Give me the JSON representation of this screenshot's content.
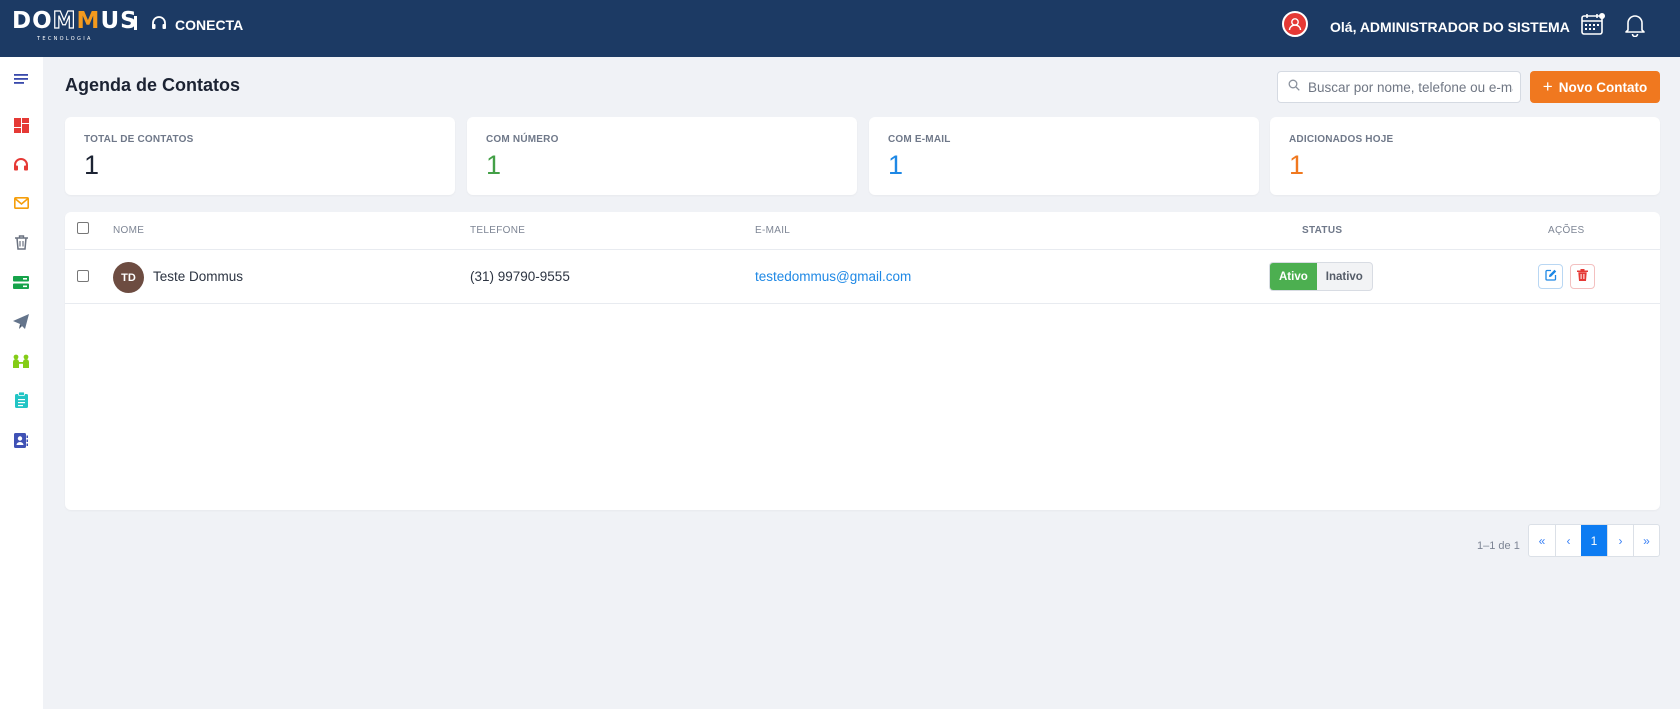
{
  "header": {
    "logo_text_a": "DO",
    "logo_text_m1": "M",
    "logo_text_m2": "M",
    "logo_text_b": "US",
    "logo_sub": "TECNOLOGIA",
    "app_name": "CONECTA",
    "greeting": "Olá, ADMINISTRADOR DO SISTEMA",
    "icons": [
      "headset-icon",
      "user-circle-icon",
      "calendar-icon",
      "bell-icon"
    ]
  },
  "sidebar": {
    "items": [
      {
        "name": "menu-toggle",
        "icon": "menu-icon",
        "color": "#3949ab"
      },
      {
        "name": "dashboard",
        "icon": "dashboard-icon",
        "color": "#e53935"
      },
      {
        "name": "atendimento",
        "icon": "headset-icon",
        "color": "#e53935"
      },
      {
        "name": "email",
        "icon": "envelope-icon",
        "color": "#f59e0b"
      },
      {
        "name": "lixeira",
        "icon": "trash-icon",
        "color": "#6b7280"
      },
      {
        "name": "servidores",
        "icon": "server-icon",
        "color": "#16a34a"
      },
      {
        "name": "envios",
        "icon": "paper-plane-icon",
        "color": "#64748b"
      },
      {
        "name": "equipes",
        "icon": "users-icon",
        "color": "#84cc16"
      },
      {
        "name": "tarefas",
        "icon": "clipboard-icon",
        "color": "#22c5c5"
      },
      {
        "name": "contatos",
        "icon": "address-book-icon",
        "color": "#3f51b5"
      }
    ]
  },
  "main": {
    "title": "Agenda de Contatos",
    "search_placeholder": "Buscar por nome, telefone ou e-mail",
    "new_button": "Novo Contato",
    "new_button_plus": "+",
    "stats": [
      {
        "label": "TOTAL DE CONTATOS",
        "value": "1",
        "color": "#1c2333"
      },
      {
        "label": "COM NÚMERO",
        "value": "1",
        "color": "#43a047"
      },
      {
        "label": "COM E-MAIL",
        "value": "1",
        "color": "#1e88e5"
      },
      {
        "label": "ADICIONADOS HOJE",
        "value": "1",
        "color": "#f0781f"
      }
    ],
    "table": {
      "headers": {
        "name": "NOME",
        "phone": "TELEFONE",
        "email": "E-MAIL",
        "status": "STATUS",
        "actions": "AÇÕES"
      },
      "rows": [
        {
          "initials": "TD",
          "name": "Teste Dommus",
          "phone": "(31) 99790-9555",
          "email": "testedommus@gmail.com",
          "status_on": "Ativo",
          "status_off": "Inativo",
          "active": true
        }
      ]
    },
    "pagination": {
      "info": "1–1 de 1",
      "first": "«",
      "prev": "‹",
      "current": "1",
      "next": "›",
      "last": "»"
    }
  }
}
